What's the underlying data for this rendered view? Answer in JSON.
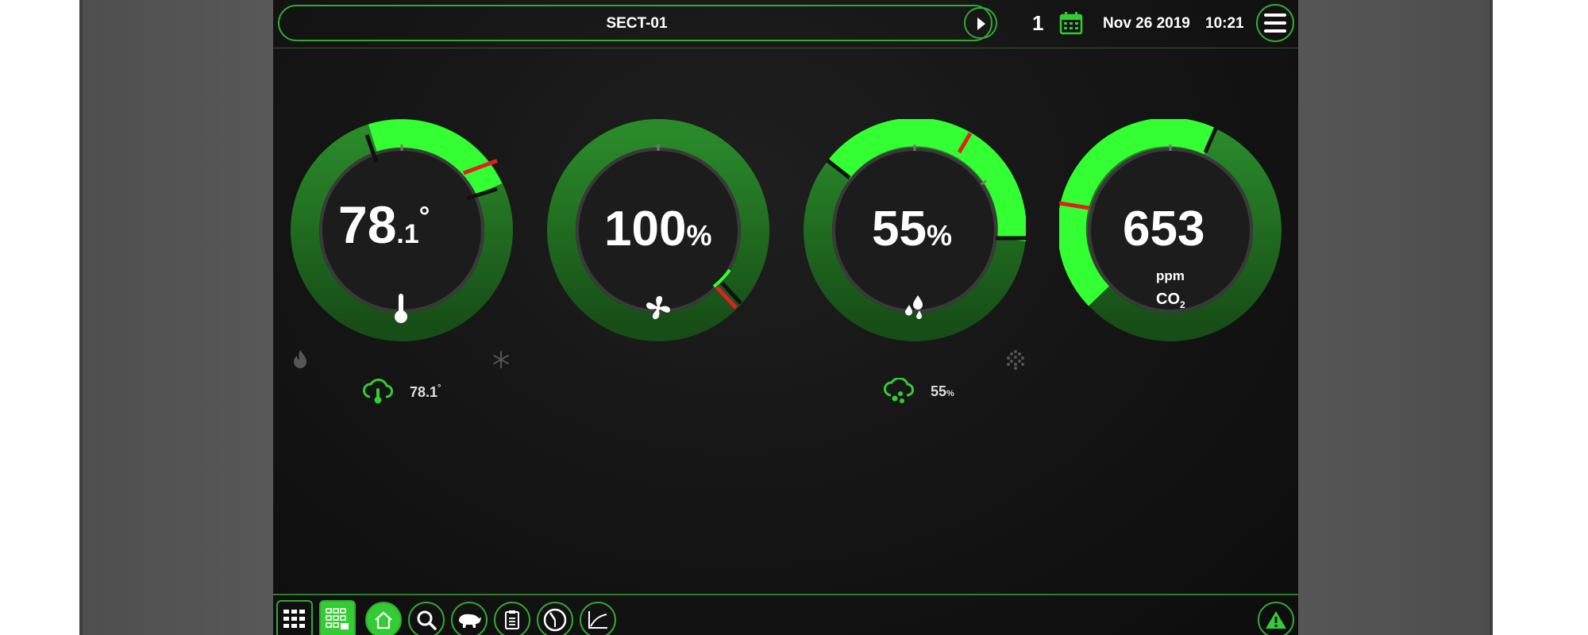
{
  "header": {
    "sector": "SECT-01",
    "room_number": "1",
    "date": "Nov 26 2019",
    "time": "10:21"
  },
  "gauges": [
    {
      "name": "temperature",
      "value_main": "78",
      "value_dec": ".1",
      "unit": "°",
      "level": 0.62,
      "icon": "thermometer-icon"
    },
    {
      "name": "ventilation",
      "value_main": "100",
      "unit": "%",
      "level": 1.0,
      "icon": "fan-icon"
    },
    {
      "name": "humidity",
      "value_main": "55",
      "unit": "%",
      "level": 0.55,
      "icon": "humidity-drops-icon"
    },
    {
      "name": "co2",
      "value_main": "653",
      "sub1": "ppm",
      "sub2": "CO",
      "sub2_sub": "2",
      "icon": "co2-icon"
    }
  ],
  "outdoor": {
    "temperature": "78.1",
    "temperature_unit": "°",
    "humidity": "55",
    "humidity_unit": "%"
  },
  "colors": {
    "accent": "#33cc33",
    "bright_green": "#33ff33",
    "dark_green": "#1f6e1f",
    "marker_red": "#e02020",
    "bezel": "#5b5b5b",
    "screen": "#141414"
  },
  "nav_icons": [
    "grid-icon",
    "multi-grid-icon",
    "home-icon",
    "search-icon",
    "animal-icon",
    "report-icon",
    "clock-icon",
    "graph-icon",
    "alarm-icon"
  ]
}
